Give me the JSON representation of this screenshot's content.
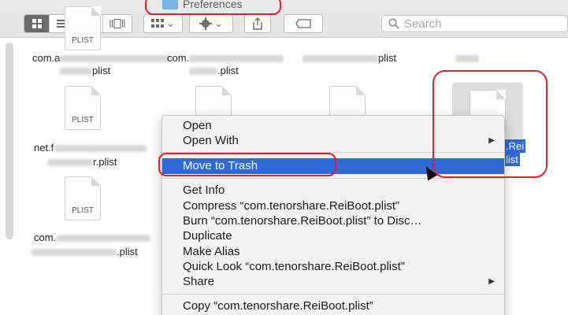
{
  "window": {
    "title": "Preferences"
  },
  "toolbar": {
    "search_placeholder": "Search",
    "chevron": "⌄"
  },
  "files": [
    {
      "name_line1": "com.a",
      "name_line2": "plist",
      "tag": "PLIST"
    },
    {
      "name_line1": "com.",
      "name_line2": ".plist",
      "tag": ""
    },
    {
      "name_line1": "",
      "name_line2": "plist",
      "tag": ""
    },
    {
      "name_line1": "net.f",
      "name_line2": "r.plist",
      "tag": "PLIST"
    },
    {
      "name_line1": "com.",
      "name_line2": ".plist",
      "tag": "PLIST"
    },
    {
      "selected_line1": ".Rei",
      "selected_line2": "list"
    }
  ],
  "context_menu": {
    "items": [
      {
        "label": "Open"
      },
      {
        "label": "Open With",
        "submenu": "▶"
      },
      {
        "label": "Move to Trash"
      },
      {
        "label": "Get Info"
      },
      {
        "label": "Compress “com.tenorshare.ReiBoot.plist”"
      },
      {
        "label": "Burn “com.tenorshare.ReiBoot.plist” to Disc…"
      },
      {
        "label": "Duplicate"
      },
      {
        "label": "Make Alias"
      },
      {
        "label": "Quick Look “com.tenorshare.ReiBoot.plist”"
      },
      {
        "label": "Share",
        "submenu": "▶"
      },
      {
        "label": "Copy “com.tenorshare.ReiBoot.plist”"
      }
    ]
  },
  "colors": {
    "highlight": "#2f69d6",
    "annotation": "#e0202a"
  }
}
